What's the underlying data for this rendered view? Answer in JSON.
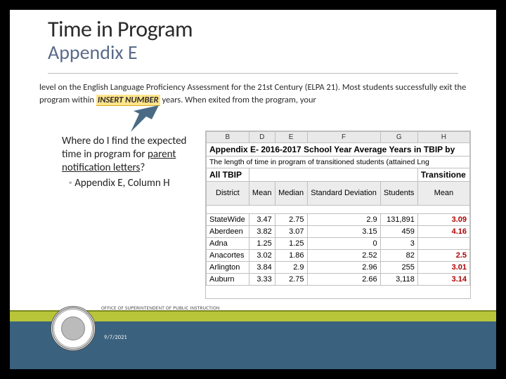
{
  "title": {
    "line1": "Time in Program",
    "line2": "Appendix E"
  },
  "paragraph": {
    "pre": "level on the English Language Proficiency Assessment for the 21st Century (ELPA 21). Most students successfully exit the program within ",
    "insert": "INSERT NUMBER",
    "post": " years. When exited from the program, your"
  },
  "question": {
    "l1": "Where do I find the expected time in program for ",
    "under": "parent notification letters",
    "qmark": "?",
    "bullet": "Appendix E, Column H"
  },
  "sheet": {
    "cols": [
      "B",
      "D",
      "E",
      "F",
      "G",
      "H"
    ],
    "caption": "Appendix E- 2016-2017 School Year Average Years in TBIP by",
    "desc": "The length of time in program of transitioned students (attained Lng",
    "allLabel": "All TBIP",
    "transLabel": "Transitione",
    "headers": [
      "District",
      "Mean",
      "Median",
      "Standard Deviation",
      "Students",
      "Mean"
    ]
  },
  "footer": {
    "office": "OFFICE OF SUPERINTENDENT OF PUBLIC INSTRUCTION",
    "date": "9/7/2021"
  },
  "chart_data": {
    "type": "table",
    "title": "Appendix E- 2016-2017 School Year Average Years in TBIP",
    "columns": [
      "District",
      "Mean",
      "Median",
      "Standard Deviation",
      "Students",
      "Transitione Mean"
    ],
    "rows": [
      {
        "district": "StateWide",
        "mean": 3.47,
        "median": 2.75,
        "stddev": 2.9,
        "students": 131891,
        "h_mean": 3.09
      },
      {
        "district": "Aberdeen",
        "mean": 3.82,
        "median": 3.07,
        "stddev": 3.15,
        "students": 459,
        "h_mean": 4.16
      },
      {
        "district": "Adna",
        "mean": 1.25,
        "median": 1.25,
        "stddev": 0.0,
        "students": 3,
        "h_mean": null
      },
      {
        "district": "Anacortes",
        "mean": 3.02,
        "median": 1.86,
        "stddev": 2.52,
        "students": 82,
        "h_mean": 2.5
      },
      {
        "district": "Arlington",
        "mean": 3.84,
        "median": 2.9,
        "stddev": 2.96,
        "students": 255,
        "h_mean": 3.01
      },
      {
        "district": "Auburn",
        "mean": 3.33,
        "median": 2.75,
        "stddev": 2.66,
        "students": 3118,
        "h_mean": 3.14
      }
    ]
  }
}
